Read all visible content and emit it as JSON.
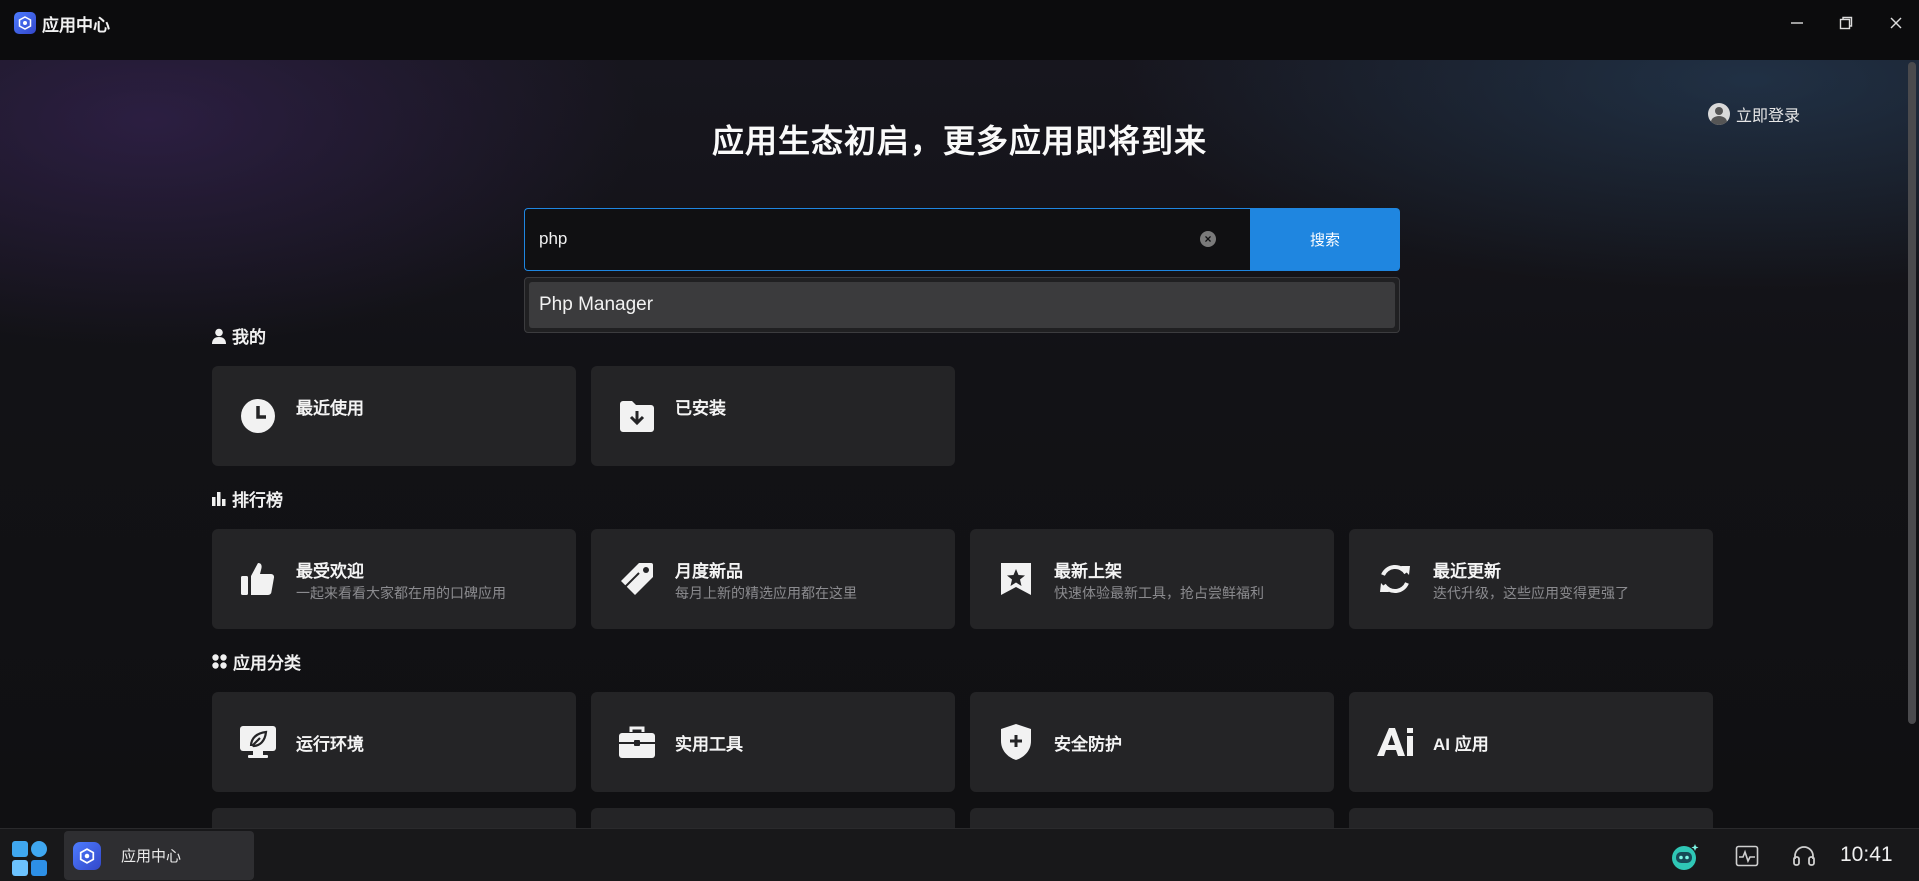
{
  "titlebar": {
    "title": "应用中心",
    "logo_icon": "app-center-icon",
    "controls": [
      "minimize-icon",
      "restore-icon",
      "close-icon"
    ]
  },
  "header": {
    "login_label": "立即登录",
    "hero_title": "应用生态初启，更多应用即将到来"
  },
  "search": {
    "value": "php",
    "button_label": "搜索",
    "suggestions": [
      "Php Manager"
    ]
  },
  "sections": {
    "mine": {
      "title": "我的",
      "cards": [
        {
          "title": "最近使用",
          "icon": "clock-icon"
        },
        {
          "title": "已安装",
          "icon": "folder-download-icon"
        }
      ]
    },
    "ranking": {
      "title": "排行榜",
      "cards": [
        {
          "title": "最受欢迎",
          "subtitle": "一起来看看大家都在用的口碑应用",
          "icon": "thumbs-up-icon"
        },
        {
          "title": "月度新品",
          "subtitle": "每月上新的精选应用都在这里",
          "icon": "tag-icon"
        },
        {
          "title": "最新上架",
          "subtitle": "快速体验最新工具，抢占尝鲜福利",
          "icon": "star-badge-icon"
        },
        {
          "title": "最近更新",
          "subtitle": "迭代升级，这些应用变得更强了",
          "icon": "refresh-icon"
        }
      ]
    },
    "categories": {
      "title": "应用分类",
      "cards": [
        {
          "title": "运行环境",
          "icon": "monitor-leaf-icon"
        },
        {
          "title": "实用工具",
          "icon": "toolbox-icon"
        },
        {
          "title": "安全防护",
          "icon": "shield-plus-icon"
        },
        {
          "title": "AI 应用",
          "icon": "ai-icon"
        }
      ]
    }
  },
  "taskbar": {
    "app_label": "应用中心",
    "time": "10:41",
    "tray_icons": [
      "assistant-robot-icon",
      "activity-monitor-icon",
      "headset-icon"
    ]
  },
  "colors": {
    "accent": "#1f86e0",
    "card_bg": "#242426",
    "background": "#101012"
  }
}
